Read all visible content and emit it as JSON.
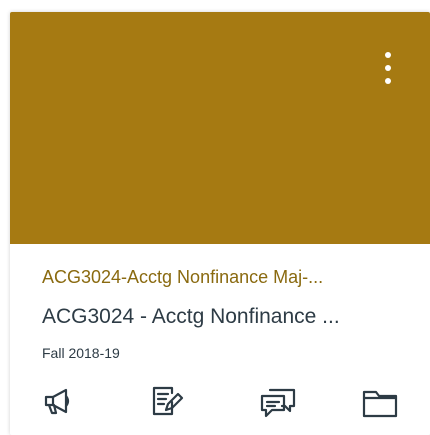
{
  "card": {
    "color": "#a67a12",
    "link_color": "#8a6a10",
    "short_name": "ACG3024-Acctg Nonfinance Maj-...",
    "name": "ACG3024 - Acctg Nonfinance ...",
    "term": "Fall 2018-19",
    "menu_icon": "more-vertical-icon",
    "actions": [
      {
        "icon": "announcements-icon"
      },
      {
        "icon": "assignments-icon"
      },
      {
        "icon": "discussions-icon"
      },
      {
        "icon": "files-icon"
      }
    ]
  }
}
